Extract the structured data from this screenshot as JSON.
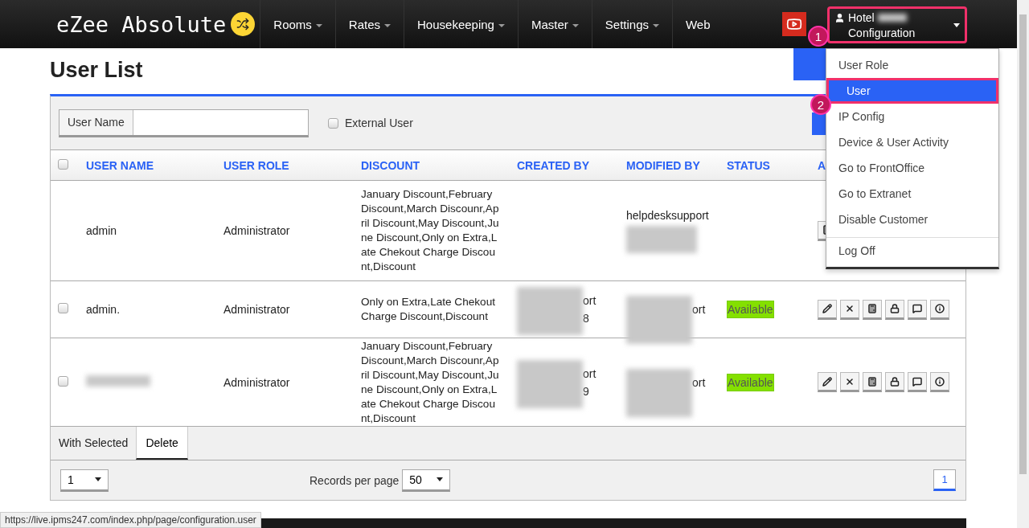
{
  "navbar": {
    "logo": "eZee Absolute",
    "menus": [
      {
        "label": "Rooms",
        "caret": true
      },
      {
        "label": "Rates",
        "caret": true
      },
      {
        "label": "Housekeeping",
        "caret": true
      },
      {
        "label": "Master",
        "caret": true
      },
      {
        "label": "Settings",
        "caret": true
      },
      {
        "label": "Web",
        "caret": false
      }
    ],
    "account": {
      "line1": "Hotel",
      "line2": "Configuration",
      "expanded": true
    }
  },
  "dropdown": {
    "items": [
      {
        "label": "User Role",
        "selected": false
      },
      {
        "label": "User",
        "selected": true
      },
      {
        "label": "IP Config",
        "selected": false
      },
      {
        "label": "Device & User Activity",
        "selected": false
      },
      {
        "label": "Go to FrontOffice",
        "selected": false
      },
      {
        "label": "Go to Extranet",
        "selected": false
      },
      {
        "label": "Disable Customer",
        "selected": false
      },
      {
        "label": "Log Off",
        "selected": false
      }
    ]
  },
  "annotations": [
    "1",
    "2"
  ],
  "page_title": "User List",
  "filter": {
    "user_name_label": "User Name",
    "external_user": {
      "label": "External User",
      "checked": false
    }
  },
  "table": {
    "select_all_checked": false,
    "columns": [
      "USER NAME",
      "USER ROLE",
      "DISCOUNT",
      "CREATED BY",
      "MODIFIED BY",
      "STATUS",
      "A"
    ],
    "rows": [
      {
        "user_name": "admin",
        "role": "Administrator",
        "discount": "January Discount,February Discount,March Discounr,April Discount,May Discount,June Discount,Only on Extra,Late Chekout Charge Discount,Discount",
        "modified_by": {
          "kind": "tail",
          "lines": [
            "helpdesksupport"
          ]
        },
        "actions": [
          {
            "kind": "calculator"
          }
        ]
      },
      {
        "checked": false,
        "user_name": "admin.",
        "role": "Administrator",
        "discount": "Only on Extra,Late Chekout Charge Discount,Discount",
        "created_by": {
          "kind": "partial",
          "lines": [
            "ort",
            "8"
          ]
        },
        "modified_by": {
          "kind": "partial",
          "lines": [
            "ort"
          ]
        },
        "status": "Available",
        "actions": [
          {
            "kind": "edit"
          },
          {
            "kind": "delete"
          },
          {
            "kind": "calculator"
          },
          {
            "kind": "lock"
          },
          {
            "kind": "comment"
          },
          {
            "kind": "info"
          }
        ]
      },
      {
        "checked": false,
        "role": "Administrator",
        "discount": "January Discount,February Discount,March Discounr,April Discount,May Discount,June Discount,Only on Extra,Late Chekout Charge Discount,Discount",
        "created_by": {
          "kind": "partial",
          "lines": [
            "ort",
            "9"
          ]
        },
        "modified_by": {
          "kind": "partial",
          "lines": [
            "ort"
          ]
        },
        "status": "Available",
        "actions": [
          {
            "kind": "edit"
          },
          {
            "kind": "delete"
          },
          {
            "kind": "calculator"
          },
          {
            "kind": "lock"
          },
          {
            "kind": "comment"
          },
          {
            "kind": "info"
          }
        ]
      }
    ]
  },
  "bulk": {
    "label": "With Selected",
    "action": "Delete"
  },
  "pager": {
    "page_select": "1",
    "records_label": "Records per page",
    "records_select": "50",
    "current_page": "1"
  },
  "status_url": "https://live.ipms247.com/index.php/page/configuration.user"
}
